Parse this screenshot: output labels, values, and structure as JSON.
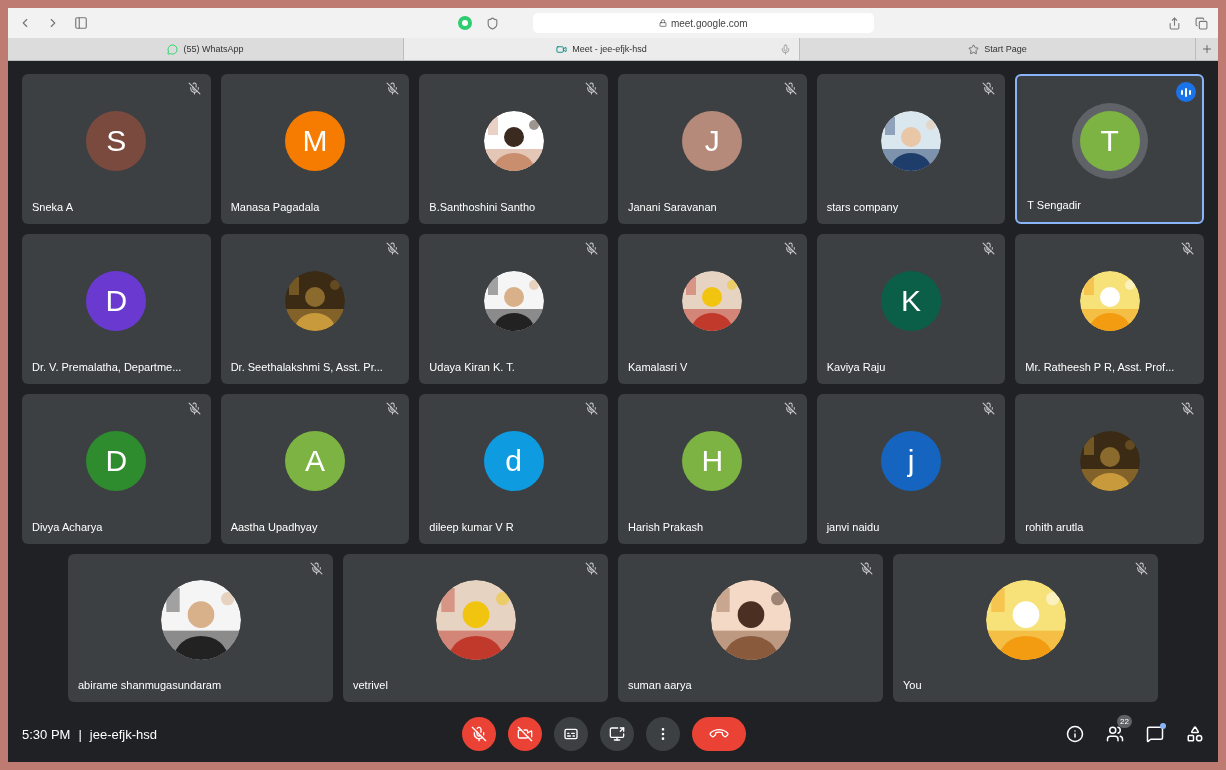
{
  "browser": {
    "address": "meet.google.com",
    "tabs": [
      {
        "label": "(55) WhatsApp",
        "selected": false,
        "kind": "whatsapp"
      },
      {
        "label": "Meet - jee-efjk-hsd",
        "selected": true,
        "kind": "meet"
      },
      {
        "label": "Start Page",
        "selected": false,
        "kind": "star"
      }
    ]
  },
  "tiles": [
    {
      "name": "Sneka A",
      "avatar": {
        "kind": "letter",
        "letter": "S",
        "color": "#7b4a3f"
      },
      "muted": true,
      "speaking": false
    },
    {
      "name": "Manasa Pagadala",
      "avatar": {
        "kind": "letter",
        "letter": "M",
        "color": "#f57c00"
      },
      "muted": true,
      "speaking": false
    },
    {
      "name": "B.Santhoshini Santho",
      "muted": true,
      "speaking": false
    },
    {
      "name": "Janani Saravanan",
      "avatar": {
        "kind": "letter",
        "letter": "J",
        "color": "#b58a7a"
      },
      "muted": true,
      "speaking": false
    },
    {
      "name": "stars company",
      "muted": true,
      "speaking": false
    },
    {
      "name": "T Sengadir",
      "avatar": {
        "kind": "letter",
        "letter": "T",
        "color": "#7cb342"
      },
      "muted": false,
      "speaking": true
    },
    {
      "name": "Dr. V. Premalatha, Departme...",
      "avatar": {
        "kind": "letter",
        "letter": "D",
        "color": "#6a3ad0"
      },
      "muted": false,
      "speaking": false
    },
    {
      "name": "Dr. Seethalakshmi S, Asst. Pr...",
      "muted": true,
      "speaking": false
    },
    {
      "name": "Udaya Kiran K. T.",
      "muted": true,
      "speaking": false
    },
    {
      "name": "Kamalasri V",
      "muted": true,
      "speaking": false
    },
    {
      "name": "Kaviya Raju",
      "avatar": {
        "kind": "letter",
        "letter": "K",
        "color": "#0b5e47"
      },
      "muted": true,
      "speaking": false
    },
    {
      "name": "Mr. Ratheesh P R, Asst. Prof...",
      "muted": true,
      "speaking": false
    },
    {
      "name": "Divya Acharya",
      "avatar": {
        "kind": "letter",
        "letter": "D",
        "color": "#2e8b2e"
      },
      "muted": true,
      "speaking": false
    },
    {
      "name": "Aastha Upadhyay",
      "avatar": {
        "kind": "letter",
        "letter": "A",
        "color": "#7cb342"
      },
      "muted": true,
      "speaking": false
    },
    {
      "name": "dileep kumar V R",
      "avatar": {
        "kind": "letter",
        "letter": "d",
        "color": "#0f9be0"
      },
      "muted": true,
      "speaking": false
    },
    {
      "name": "Harish Prakash",
      "avatar": {
        "kind": "letter",
        "letter": "H",
        "color": "#7cb342"
      },
      "muted": true,
      "speaking": false
    },
    {
      "name": "janvi naidu",
      "avatar": {
        "kind": "letter",
        "letter": "j",
        "color": "#1565c0"
      },
      "muted": true,
      "speaking": false
    },
    {
      "name": "rohith arutla",
      "muted": true,
      "speaking": false
    },
    {
      "name": "abirame shanmugasundaram",
      "muted": true,
      "speaking": false
    },
    {
      "name": "vetrivel",
      "muted": true,
      "speaking": false
    },
    {
      "name": "suman aarya",
      "muted": true,
      "speaking": false
    },
    {
      "name": "You",
      "muted": true,
      "speaking": false
    }
  ],
  "bottom_bar": {
    "time": "5:30 PM",
    "separator": "|",
    "meeting_code": "jee-efjk-hsd",
    "controls": [
      {
        "kind": "mic",
        "on": false
      },
      {
        "kind": "camera",
        "on": false
      },
      {
        "kind": "captions"
      },
      {
        "kind": "present"
      },
      {
        "kind": "more"
      },
      {
        "kind": "leave"
      }
    ],
    "participants_badge": "22"
  }
}
